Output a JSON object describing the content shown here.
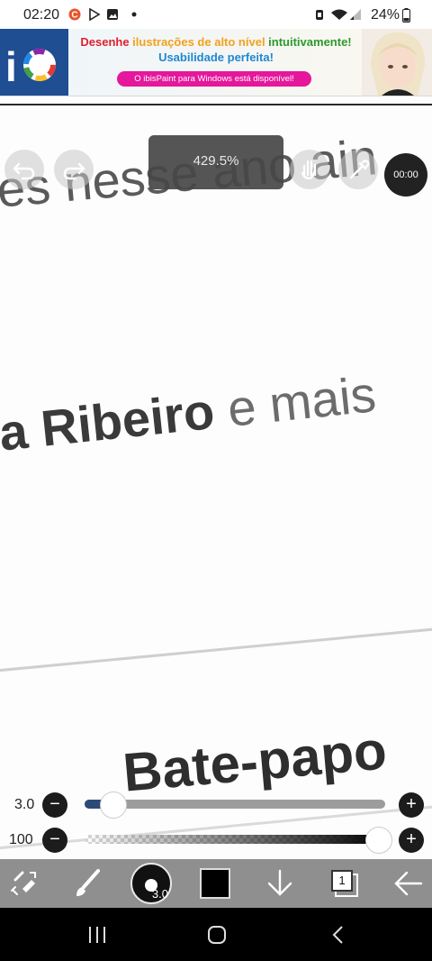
{
  "status_bar": {
    "time": "02:20",
    "battery": "24%",
    "icons": [
      "c-app-icon",
      "play-store-icon",
      "gallery-icon",
      "dot-icon",
      "alarm-icon",
      "wifi-icon",
      "signal-icon",
      "battery-icon"
    ]
  },
  "ad": {
    "line1_parts": [
      {
        "text": "Desenhe ",
        "color": "#e01f2d"
      },
      {
        "text": "ilustrações de alto nível ",
        "color": "#f2a11d"
      },
      {
        "text": "intuitivamente!",
        "color": "#2b9a2b"
      }
    ],
    "line2": "Usabilidade perfeita!",
    "pill": "O ibisPaint para Windows está disponível!"
  },
  "canvas": {
    "text_top": "es nesse ano ain",
    "text_name_bold": "a Ribeiro",
    "text_name_rest": " e mais",
    "text_chat": "Bate-papo",
    "zoom": "429.5%",
    "timer": "00:00"
  },
  "sliders": {
    "size_label": "3.0",
    "size_value": 0.095,
    "opacity_label": "100",
    "opacity_value": 1.0
  },
  "toolbar": {
    "brush_size": "3.0",
    "layer_count": "1",
    "color": "#000000"
  }
}
